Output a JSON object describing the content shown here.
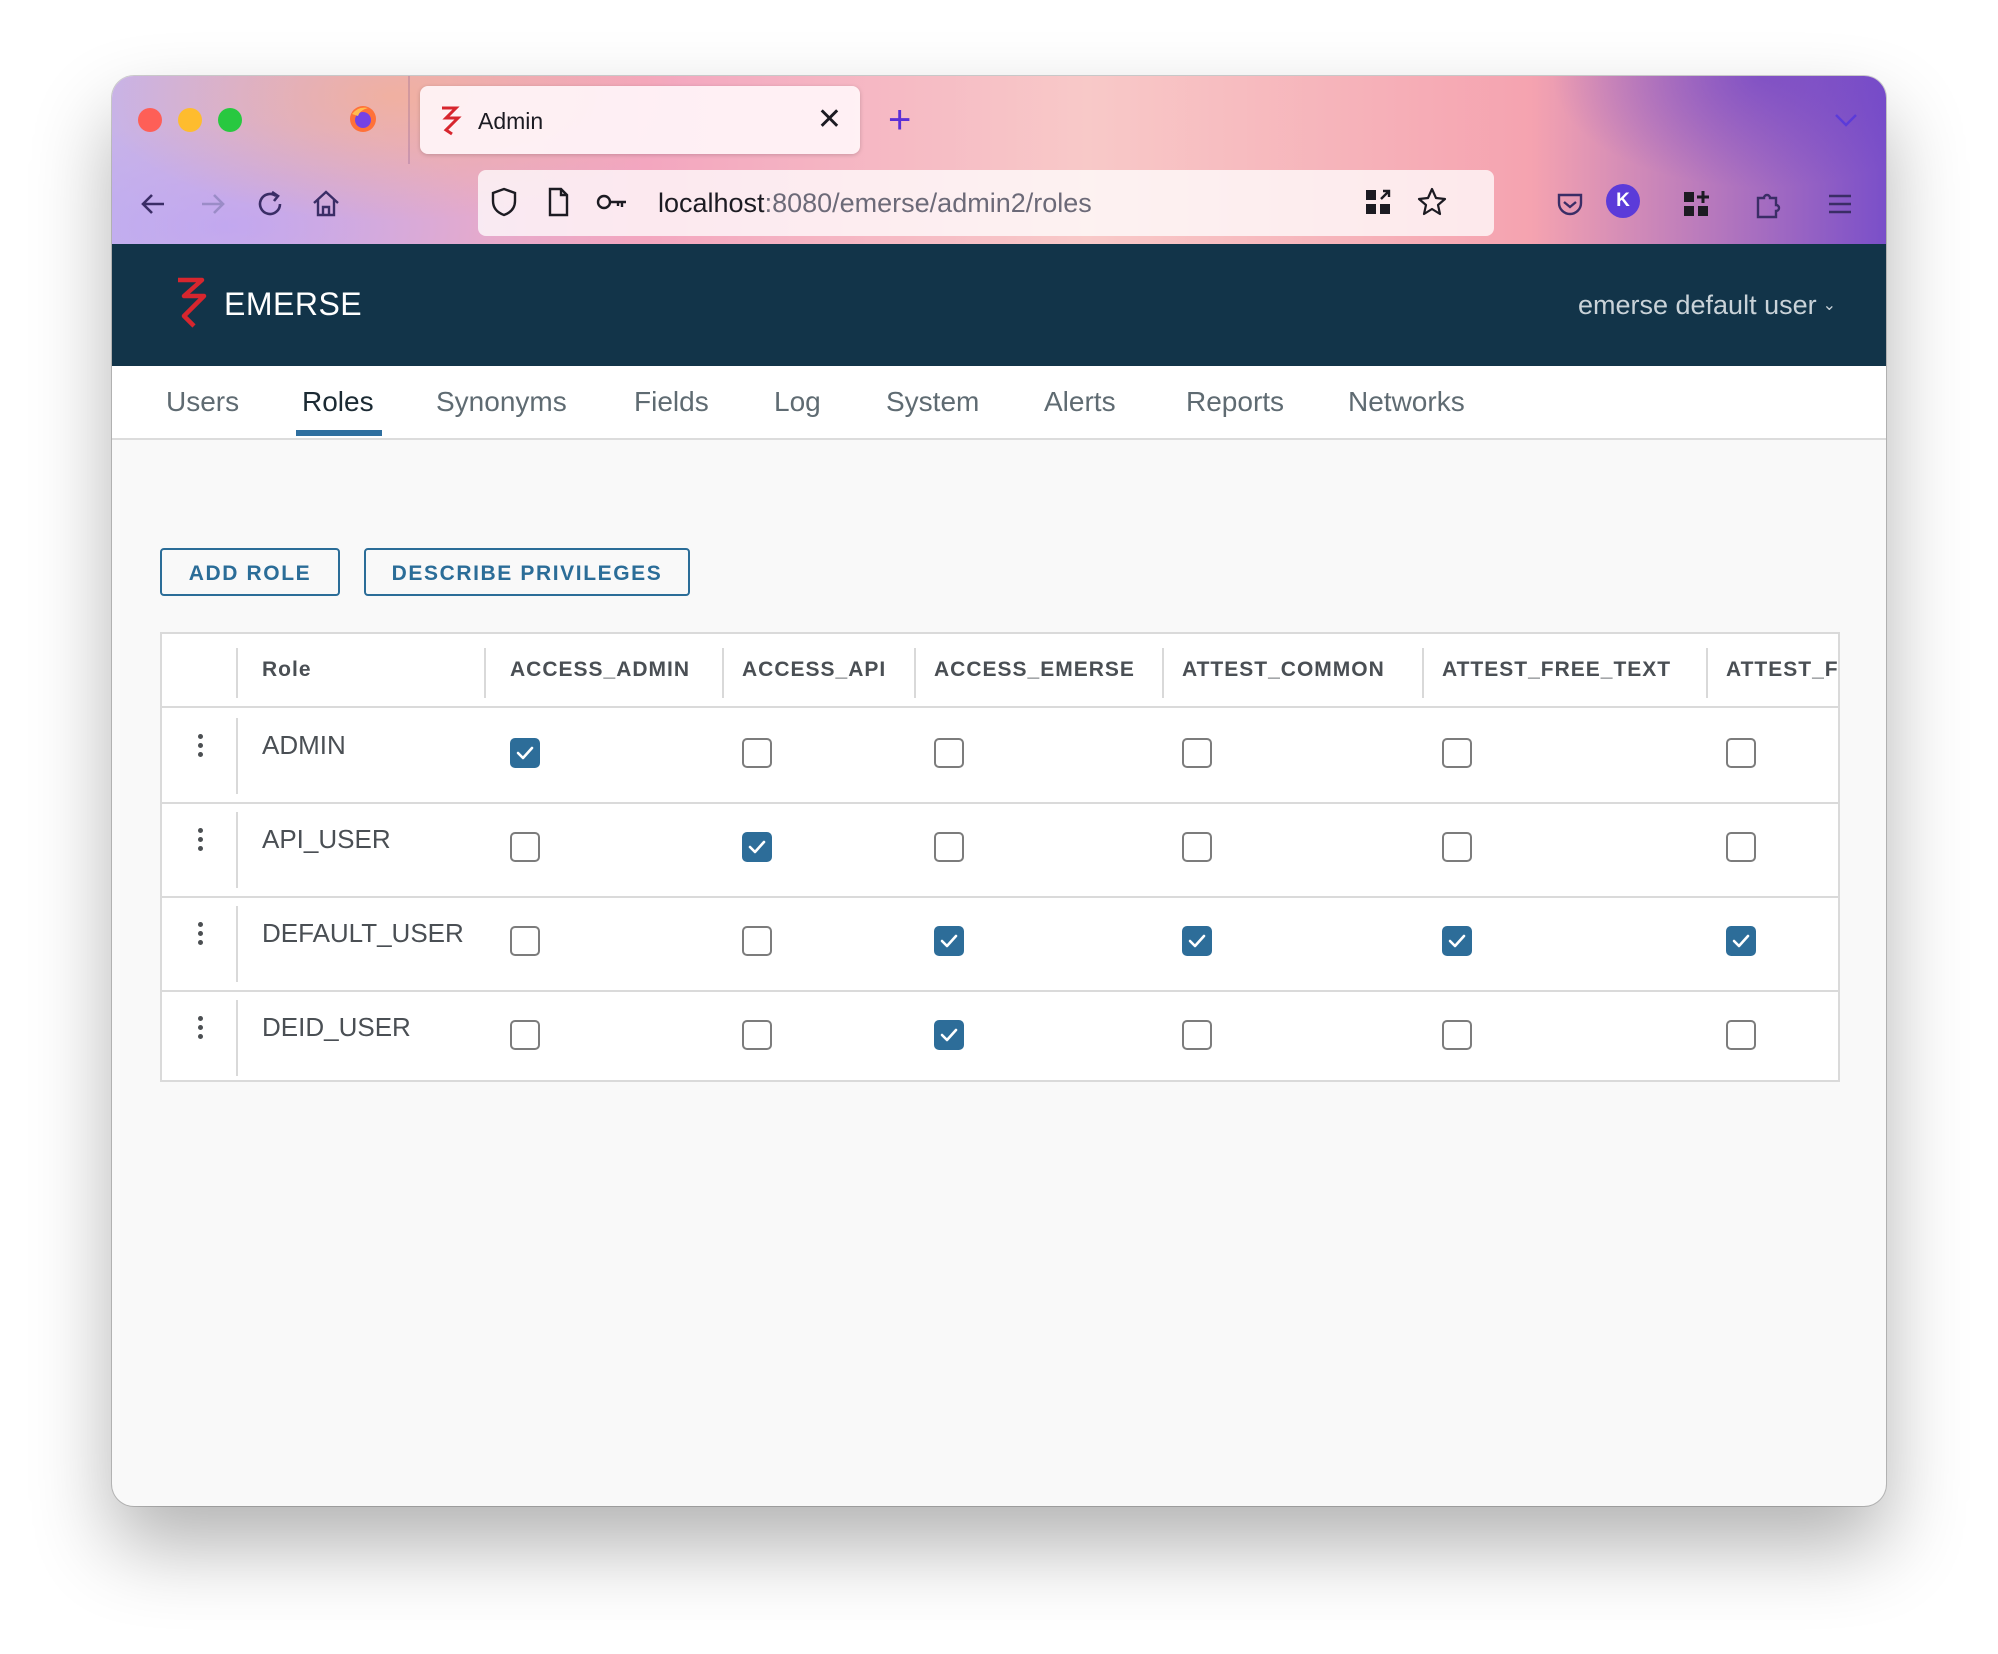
{
  "browser": {
    "tab_title": "Admin",
    "url_host": "localhost",
    "url_path": ":8080/emerse/admin2/roles",
    "profile_initial": "K"
  },
  "header": {
    "brand": "EMERSE",
    "user": "emerse default user"
  },
  "tabs": [
    {
      "label": "Users",
      "active": false
    },
    {
      "label": "Roles",
      "active": true
    },
    {
      "label": "Synonyms",
      "active": false
    },
    {
      "label": "Fields",
      "active": false
    },
    {
      "label": "Log",
      "active": false
    },
    {
      "label": "System",
      "active": false
    },
    {
      "label": "Alerts",
      "active": false
    },
    {
      "label": "Reports",
      "active": false
    },
    {
      "label": "Networks",
      "active": false
    }
  ],
  "actions": {
    "add_role": "ADD ROLE",
    "describe_privileges": "DESCRIBE PRIVILEGES"
  },
  "table": {
    "role_header": "Role",
    "columns": [
      "ACCESS_ADMIN",
      "ACCESS_API",
      "ACCESS_EMERSE",
      "ATTEST_COMMON",
      "ATTEST_FREE_TEXT",
      "ATTEST_F"
    ],
    "rows": [
      {
        "role": "ADMIN",
        "checked": [
          true,
          false,
          false,
          false,
          false,
          false
        ]
      },
      {
        "role": "API_USER",
        "checked": [
          false,
          true,
          false,
          false,
          false,
          false
        ]
      },
      {
        "role": "DEFAULT_USER",
        "checked": [
          false,
          false,
          true,
          true,
          true,
          true
        ]
      },
      {
        "role": "DEID_USER",
        "checked": [
          false,
          false,
          true,
          false,
          false,
          false
        ]
      }
    ]
  },
  "colors": {
    "header_bg": "#123449",
    "accent": "#2d6d99",
    "brand_red": "#d7262e"
  }
}
